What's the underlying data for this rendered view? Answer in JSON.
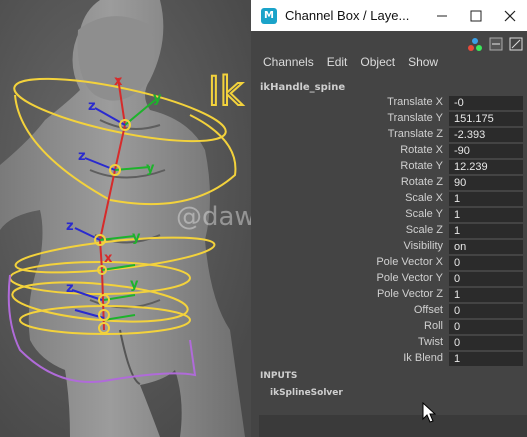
{
  "window": {
    "title": "Channel Box / Laye...",
    "app_icon": "maya-icon"
  },
  "menu": [
    "Channels",
    "Edit",
    "Object",
    "Show"
  ],
  "node": "ikHandle_spine",
  "channels": [
    {
      "label": "Translate X",
      "value": "-0"
    },
    {
      "label": "Translate Y",
      "value": "151.175"
    },
    {
      "label": "Translate Z",
      "value": "-2.393"
    },
    {
      "label": "Rotate X",
      "value": "-90"
    },
    {
      "label": "Rotate Y",
      "value": "12.239"
    },
    {
      "label": "Rotate Z",
      "value": "90"
    },
    {
      "label": "Scale X",
      "value": "1"
    },
    {
      "label": "Scale Y",
      "value": "1"
    },
    {
      "label": "Scale Z",
      "value": "1"
    },
    {
      "label": "Visibility",
      "value": "on"
    },
    {
      "label": "Pole Vector X",
      "value": "0"
    },
    {
      "label": "Pole Vector Y",
      "value": "0"
    },
    {
      "label": "Pole Vector Z",
      "value": "1"
    },
    {
      "label": "Offset",
      "value": "0"
    },
    {
      "label": "Roll",
      "value": "0"
    },
    {
      "label": "Twist",
      "value": "0"
    },
    {
      "label": "Ik Blend",
      "value": "1"
    }
  ],
  "inputs": {
    "header": "INPUTS",
    "item": "ikSplineSolver"
  },
  "viewport": {
    "watermark": "@dawn_arc",
    "ik_label": "Ik",
    "axis_y": "y",
    "axis_z": "z",
    "axis_x": "x"
  },
  "colors": {
    "panel_bg": "#444444",
    "field_bg": "#2b2b2b",
    "curve": "#f3d23c",
    "purple_curve": "#b06bd9"
  }
}
